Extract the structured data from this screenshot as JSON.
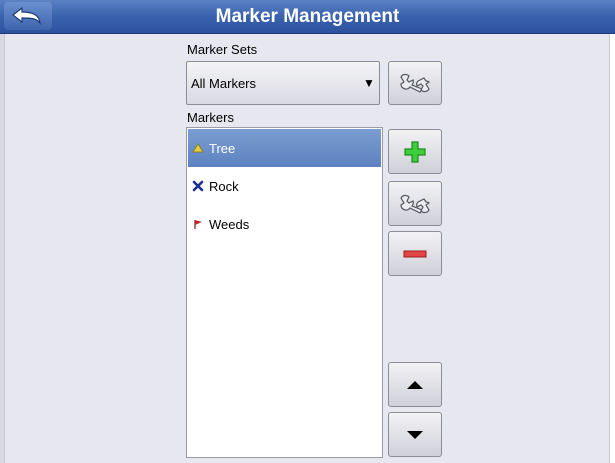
{
  "header": {
    "title": "Marker Management"
  },
  "marker_sets": {
    "label": "Marker Sets",
    "selected": "All Markers"
  },
  "markers": {
    "label": "Markers",
    "items": [
      {
        "label": "Tree",
        "icon": "tree-marker-icon",
        "selected": true,
        "color": "#d8c23a"
      },
      {
        "label": "Rock",
        "icon": "rock-marker-icon",
        "selected": false,
        "color": "#1c2f8f"
      },
      {
        "label": "Weeds",
        "icon": "weeds-marker-icon",
        "selected": false,
        "color": "#c0272d"
      }
    ]
  },
  "icons": {
    "back": "back-arrow-icon",
    "edit": "wrench-icon",
    "add": "plus-icon",
    "remove": "minus-icon",
    "up": "arrow-up-icon",
    "down": "arrow-down-icon"
  },
  "colors": {
    "title_bar": "#3a62ad",
    "selection": "#6a8fc8",
    "add_green": "#2fbf2f",
    "remove_red": "#d23a3a"
  }
}
